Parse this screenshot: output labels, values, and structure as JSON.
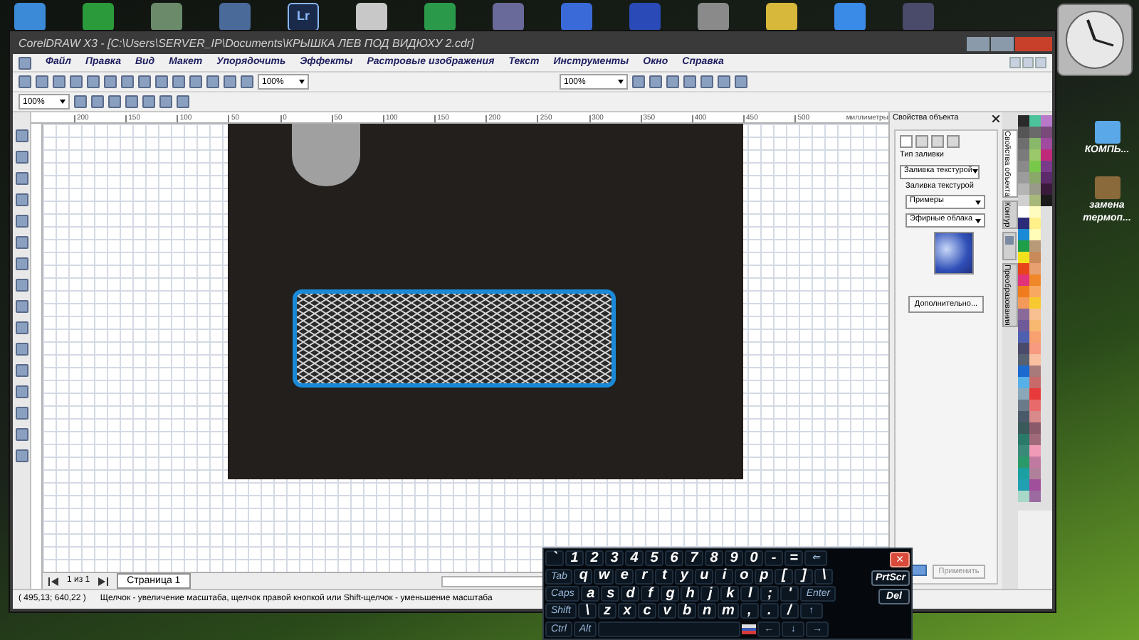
{
  "taskbar": {
    "apps": [
      {
        "kind": "icon"
      },
      {
        "kind": "icon"
      },
      {
        "kind": "icon"
      },
      {
        "kind": "icon"
      },
      {
        "kind": "text",
        "label": "Lr"
      },
      {
        "kind": "icon"
      },
      {
        "kind": "icon"
      },
      {
        "kind": "icon"
      },
      {
        "kind": "icon"
      },
      {
        "kind": "icon"
      },
      {
        "kind": "icon"
      },
      {
        "kind": "icon"
      },
      {
        "kind": "icon"
      },
      {
        "kind": "icon"
      }
    ]
  },
  "desktop_icons": [
    {
      "label": "КОМПЬ..."
    },
    {
      "label": "замена термоп..."
    }
  ],
  "window": {
    "title": "CorelDRAW X3 - [C:\\Users\\SERVER_IP\\Documents\\КРЫШКА ЛЕВ ПОД ВИДЮХУ 2.cdr]"
  },
  "menu": [
    "Файл",
    "Правка",
    "Вид",
    "Макет",
    "Упорядочить",
    "Эффекты",
    "Растровые изображения",
    "Текст",
    "Инструменты",
    "Окно",
    "Справка"
  ],
  "toolbar": {
    "zoom_1": "100%",
    "zoom_2": "100%",
    "zoom_3": "100%"
  },
  "ruler": {
    "labels": [
      "200",
      "150",
      "100",
      "50",
      "0",
      "50",
      "100",
      "150",
      "200",
      "250",
      "300",
      "350",
      "400",
      "450",
      "500"
    ],
    "unit": "миллиметры"
  },
  "docker": {
    "title": "Свойства объекта",
    "fill_type_label": "Тип заливки",
    "fill_type": "Заливка текстурой",
    "texture_label": "Заливка текстурой",
    "library": "Примеры",
    "texture": "Эфирные облака",
    "more_button": "Дополнительно...",
    "apply_button": "Применить",
    "tabs": [
      {
        "kind": "text",
        "label": "Свойства объекта",
        "selected": true
      },
      {
        "kind": "text",
        "label": "Контур",
        "selected": false
      },
      {
        "kind": "icon",
        "selected": false
      },
      {
        "kind": "text",
        "label": "Преобразования",
        "selected": false
      }
    ]
  },
  "canvas": {
    "page_tab": "Страница 1",
    "page_count": "1 из 1"
  },
  "status_bar": {
    "coordinates": "( 495,13; 640,22 )",
    "hint": "Щелчок - увеличение масштаба, щелчок правой кнопкой или Shift-щелчок - уменьшение масштаба"
  },
  "keyboard": {
    "rows": [
      [
        {
          "label": "`",
          "kind": "char"
        },
        {
          "label": "1",
          "kind": "char"
        },
        {
          "label": "2",
          "kind": "char"
        },
        {
          "label": "3",
          "kind": "char"
        },
        {
          "label": "4",
          "kind": "char"
        },
        {
          "label": "5",
          "kind": "char"
        },
        {
          "label": "6",
          "kind": "char"
        },
        {
          "label": "7",
          "kind": "char"
        },
        {
          "label": "8",
          "kind": "char"
        },
        {
          "label": "9",
          "kind": "char"
        },
        {
          "label": "0",
          "kind": "char"
        },
        {
          "label": "-",
          "kind": "char"
        },
        {
          "label": "=",
          "kind": "char"
        },
        {
          "label": "⇐",
          "kind": "mod"
        }
      ],
      [
        {
          "label": "Tab",
          "kind": "mod"
        },
        {
          "label": "q",
          "kind": "char"
        },
        {
          "label": "w",
          "kind": "char"
        },
        {
          "label": "e",
          "kind": "char"
        },
        {
          "label": "r",
          "kind": "char"
        },
        {
          "label": "t",
          "kind": "char"
        },
        {
          "label": "y",
          "kind": "char"
        },
        {
          "label": "u",
          "kind": "char"
        },
        {
          "label": "i",
          "kind": "char"
        },
        {
          "label": "o",
          "kind": "char"
        },
        {
          "label": "p",
          "kind": "char"
        },
        {
          "label": "[",
          "kind": "char"
        },
        {
          "label": "]",
          "kind": "char"
        },
        {
          "label": "\\",
          "kind": "char"
        }
      ],
      [
        {
          "label": "Caps",
          "kind": "mod"
        },
        {
          "label": "a",
          "kind": "char"
        },
        {
          "label": "s",
          "kind": "char"
        },
        {
          "label": "d",
          "kind": "char"
        },
        {
          "label": "f",
          "kind": "char"
        },
        {
          "label": "g",
          "kind": "char"
        },
        {
          "label": "h",
          "kind": "char"
        },
        {
          "label": "j",
          "kind": "char"
        },
        {
          "label": "k",
          "kind": "char"
        },
        {
          "label": "l",
          "kind": "char"
        },
        {
          "label": ";",
          "kind": "char"
        },
        {
          "label": "'",
          "kind": "char"
        },
        {
          "label": "Enter",
          "kind": "mod"
        }
      ],
      [
        {
          "label": "Shift",
          "kind": "mod"
        },
        {
          "label": "\\",
          "kind": "char"
        },
        {
          "label": "z",
          "kind": "char"
        },
        {
          "label": "x",
          "kind": "char"
        },
        {
          "label": "c",
          "kind": "char"
        },
        {
          "label": "v",
          "kind": "char"
        },
        {
          "label": "b",
          "kind": "char"
        },
        {
          "label": "n",
          "kind": "char"
        },
        {
          "label": "m",
          "kind": "char"
        },
        {
          "label": ",",
          "kind": "char"
        },
        {
          "label": ".",
          "kind": "char"
        },
        {
          "label": "/",
          "kind": "char"
        },
        {
          "label": "↑",
          "kind": "mod"
        }
      ],
      [
        {
          "label": "Ctrl",
          "kind": "mod"
        },
        {
          "label": "Alt",
          "kind": "mod"
        },
        {
          "kind": "space"
        },
        {
          "kind": "flag"
        },
        {
          "label": "←",
          "kind": "mod"
        },
        {
          "label": "↓",
          "kind": "mod"
        },
        {
          "label": "→",
          "kind": "mod"
        }
      ]
    ],
    "side_keys": [
      {
        "label": "×",
        "kind": "close"
      },
      {
        "label": "PrtScr",
        "kind": "side"
      },
      {
        "label": "Del",
        "kind": "side"
      }
    ]
  }
}
